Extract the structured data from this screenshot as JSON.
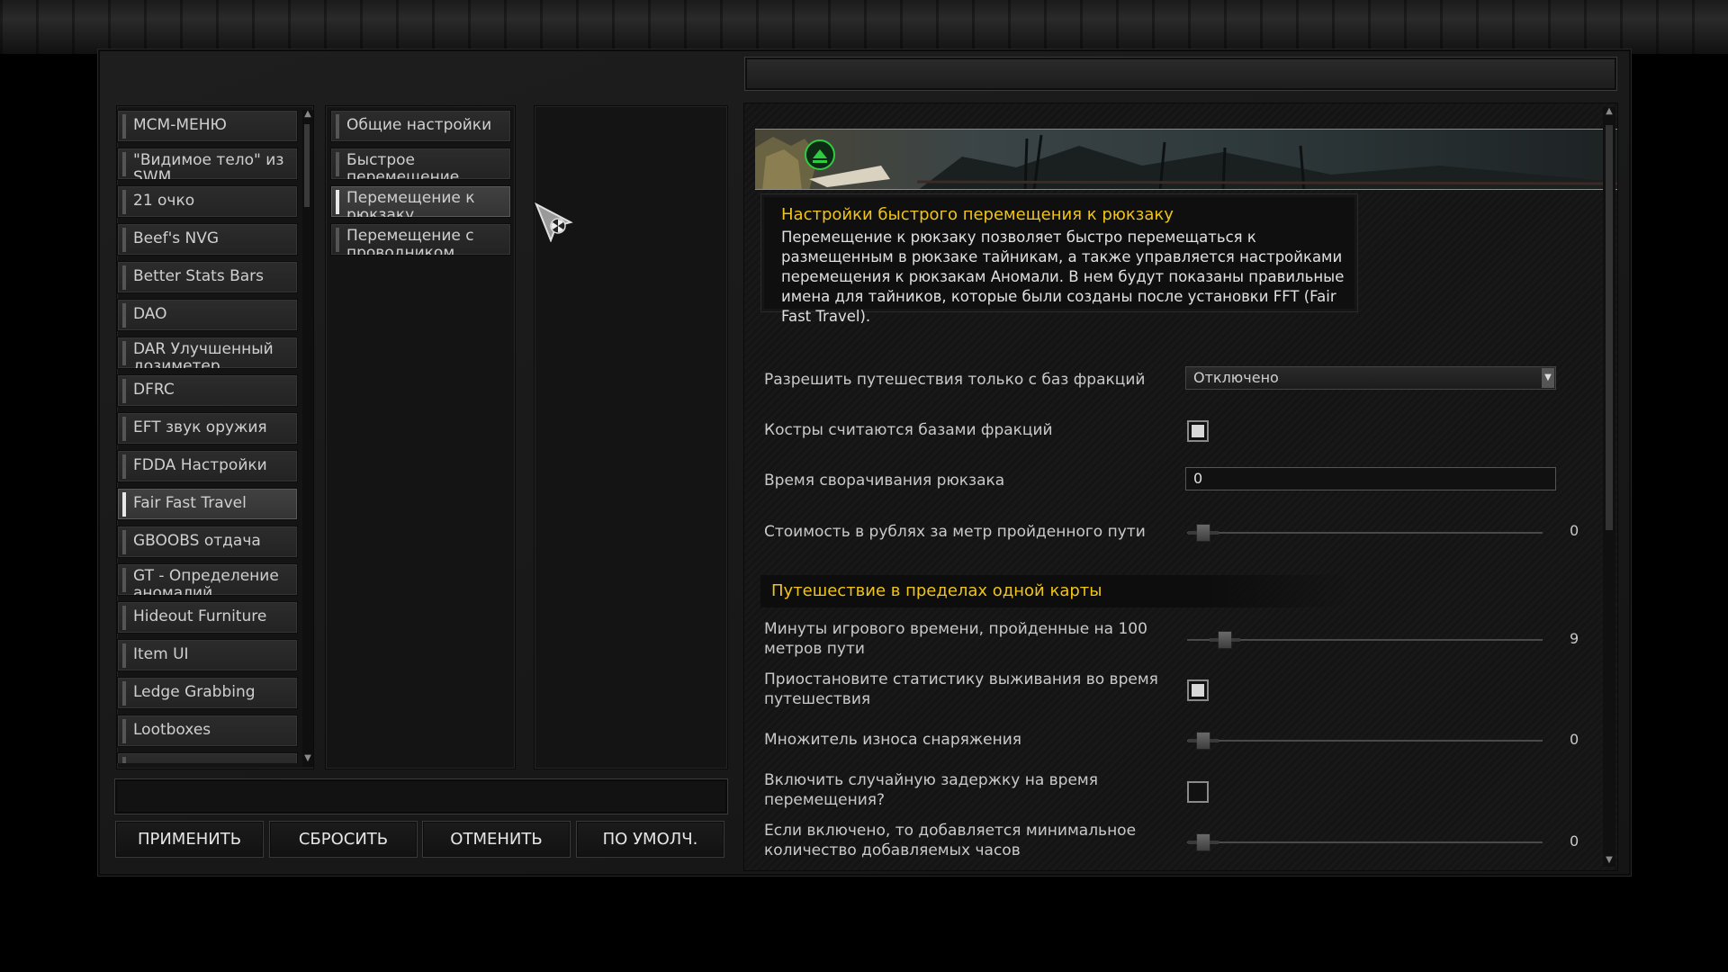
{
  "left_list": [
    "MCM-МЕНЮ",
    "\"Видимое тело\" из SWM",
    "21 очко",
    "Beef's NVG",
    "Better Stats Bars",
    "DAO",
    "DAR Улучшенный дозиметер",
    "DFRC",
    "EFT звук оружия",
    "FDDA Настройки",
    "Fair Fast Travel",
    "GBOOBS отдача",
    "GT - Определение аномалий",
    "Hideout Furniture",
    "Item UI Improvements",
    "Ledge Grabbing",
    "Lootboxes"
  ],
  "selected_mod": "Fair Fast Travel",
  "sub_list": [
    "Общие настройки",
    "Быстрое перемещение",
    "Перемещение к рюкзаку",
    "Перемещение с проводником"
  ],
  "selected_sub": "Перемещение к рюкзаку",
  "buttons": {
    "apply": "ПРИМЕНИТЬ",
    "reset": "СБРОСИТЬ",
    "cancel": "ОТМЕНИТЬ",
    "defaults": "ПО УМОЛЧ."
  },
  "description": {
    "title": "Настройки быстрого перемещения к рюкзаку",
    "text": "Перемещение к рюкзаку позволяет быстро перемещаться к размещенным в рюкзаке тайникам, а также управляется настройками перемещения к рюкзакам Аномали. В нем будут показаны правильные имена для тайников, которые были созданы после установки FFT (Fair Fast Travel)."
  },
  "options": {
    "faction_only_label": "Разрешить путешествия только с баз фракций",
    "faction_only_value": "Отключено",
    "campfires_label": "Костры считаются базами фракций",
    "campfires_checked": true,
    "pack_time_label": "Время сворачивания рюкзака",
    "pack_time_value": "0",
    "cost_label": "Стоимость в рублях за метр пройденного пути",
    "cost_value": "0",
    "section_same_map": "Путешествие в пределах одной карты",
    "minutes_label": "Минуты игрового времени, пройденные на 100 метров пути",
    "minutes_value": "9",
    "pause_stats_label": "Приостановите статистику выживания во время путешествия",
    "pause_stats_checked": true,
    "wear_label": "Множитель износа снаряжения",
    "wear_value": "0",
    "random_delay_label": "Включить случайную задержку на время перемещения?",
    "random_delay_checked": false,
    "min_hours_label": "Если включено, то добавляется минимальное количество добавляемых часов",
    "min_hours_value": "0"
  },
  "colors": {
    "accent_yellow": "#f0c419",
    "badge_green": "#2ecc40"
  }
}
